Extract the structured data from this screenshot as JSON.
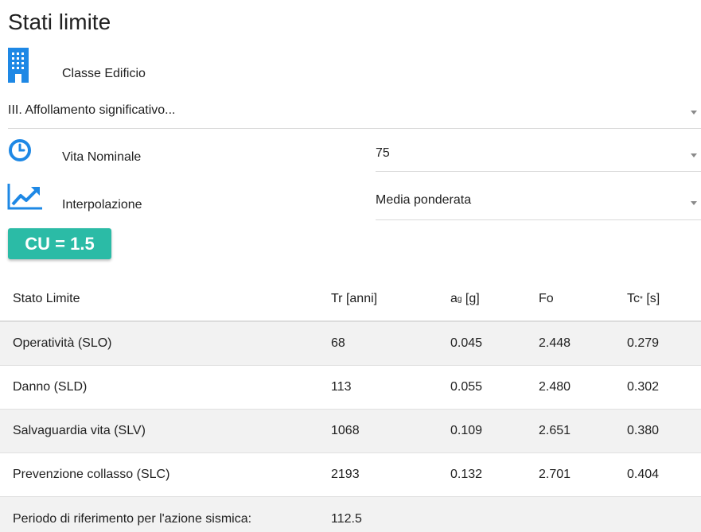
{
  "page": {
    "title": "Stati limite"
  },
  "classe_edificio": {
    "label": "Classe Edificio",
    "value": "III. Affollamento significativo..."
  },
  "vita_nominale": {
    "label": "Vita Nominale",
    "value": "75"
  },
  "interpolazione": {
    "label": "Interpolazione",
    "value": "Media ponderata"
  },
  "cu_badge": "CU = 1.5",
  "table": {
    "headers": {
      "stato": "Stato Limite",
      "tr": "Tr [anni]",
      "ag_base": "a",
      "ag_sub": "g",
      "ag_unit": " [g]",
      "fo": "Fo",
      "tc_base": "Tc",
      "tc_sup": "*",
      "tc_unit": " [s]"
    },
    "rows": [
      {
        "stato": "Operatività (SLO)",
        "tr": "68",
        "ag": "0.045",
        "fo": "2.448",
        "tc": "0.279"
      },
      {
        "stato": "Danno (SLD)",
        "tr": "113",
        "ag": "0.055",
        "fo": "2.480",
        "tc": "0.302"
      },
      {
        "stato": "Salvaguardia vita (SLV)",
        "tr": "1068",
        "ag": "0.109",
        "fo": "2.651",
        "tc": "0.380"
      },
      {
        "stato": "Prevenzione collasso (SLC)",
        "tr": "2193",
        "ag": "0.132",
        "fo": "2.701",
        "tc": "0.404"
      }
    ],
    "footer": {
      "label": "Periodo di riferimento per l'azione sismica:",
      "value": "112.5"
    }
  },
  "colors": {
    "accent_blue": "#1e88e5",
    "badge_teal": "#2bbba6"
  }
}
